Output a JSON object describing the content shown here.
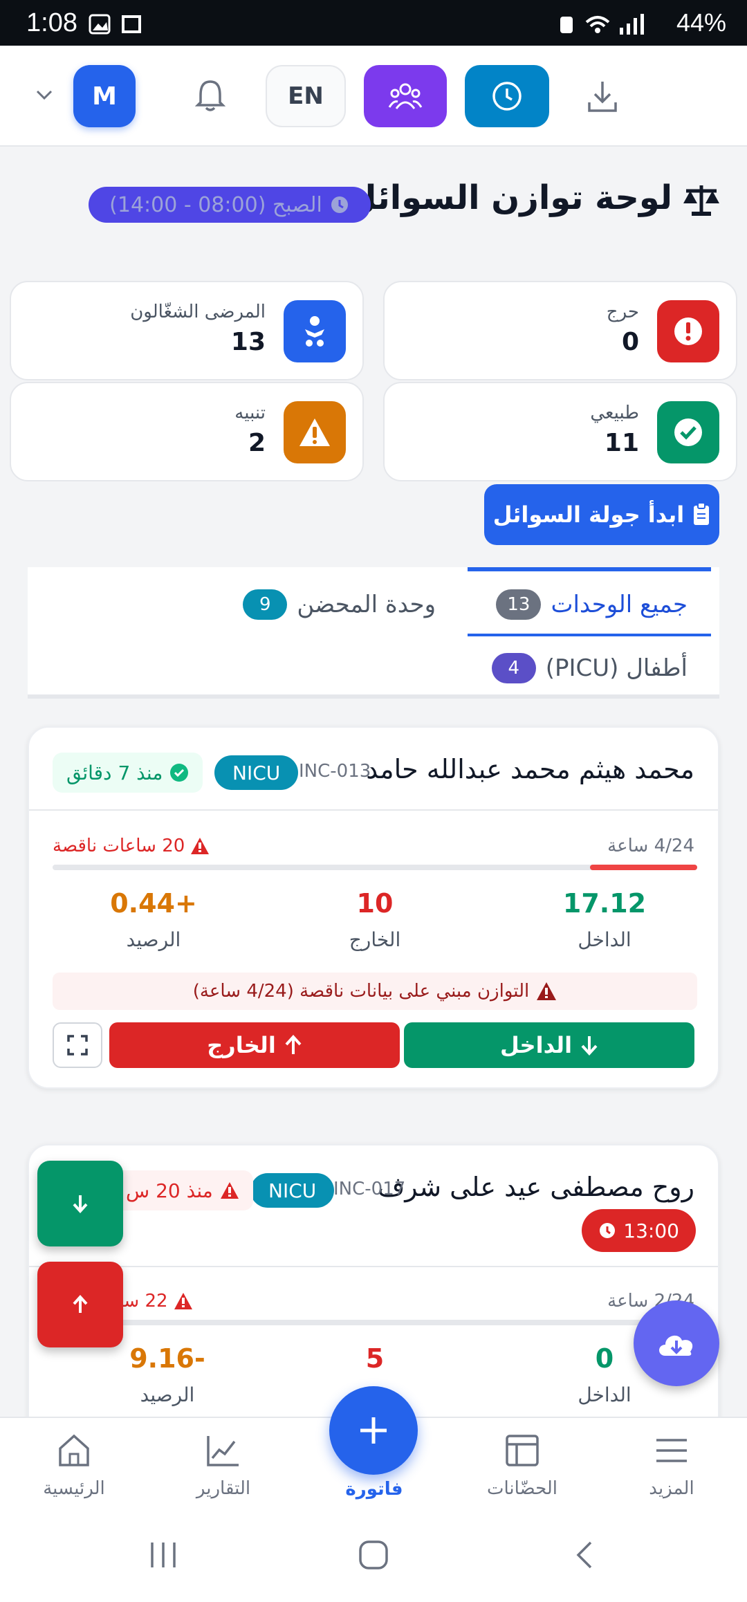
{
  "status_bar": {
    "time": "1:08",
    "battery": "44%"
  },
  "topbar": {
    "avatar_letter": "M",
    "language": "EN"
  },
  "page": {
    "title": "لوحة توازن السوائل",
    "shift": "الصبح (08:00 - 14:00)"
  },
  "stats": [
    {
      "label": "حرج",
      "value": "0",
      "color": "#dc2626",
      "icon": "alert-circle-icon"
    },
    {
      "label": "المرضى الشغّالون",
      "value": "13",
      "color": "#2563eb",
      "icon": "baby-icon"
    },
    {
      "label": "طبيعي",
      "value": "11",
      "color": "#059669",
      "icon": "check-circle-icon"
    },
    {
      "label": "تنبيه",
      "value": "2",
      "color": "#d97706",
      "icon": "warning-icon"
    }
  ],
  "start_round_label": "ابدأ جولة السوائل",
  "tabs": [
    {
      "label": "جميع الوحدات",
      "count": "13",
      "active": true
    },
    {
      "label": "وحدة المحضن",
      "count": "9"
    },
    {
      "label": "أطفال (PICU)",
      "count": "4"
    }
  ],
  "patients": [
    {
      "name": "محمد هيثم محمد عبدالله حامد",
      "id": "INC-013",
      "unit": "NICU",
      "updated": "منذ 7 دقائق",
      "hours": "4/24 ساعة",
      "missing": "20 ساعات ناقصة",
      "progress": 0.1667,
      "intake": "17.12",
      "intake_label": "الداخل",
      "output": "10",
      "output_label": "الخارج",
      "balance": "0.44+",
      "balance_label": "الرصيد",
      "warning": "التوازن مبني على بيانات ناقصة (4/24 ساعة)",
      "btn_in": "الداخل",
      "btn_out": "الخارج"
    },
    {
      "name": "روح مصطفى عيد على شرف",
      "id": "INC-017",
      "unit": "NICU",
      "updated": "منذ 20 س",
      "due": "13:00",
      "hours": "2/24 ساعة",
      "missing": "22 ساعة",
      "intake": "0",
      "intake_label": "الداخل",
      "output": "5",
      "balance": "9.16-",
      "balance_label": "الرصيد"
    }
  ],
  "bottom_nav": [
    {
      "label": "الرئيسية",
      "icon": "home-icon"
    },
    {
      "label": "التقارير",
      "icon": "chart-icon"
    },
    {
      "label": "فاتورة",
      "icon": "plus-icon"
    },
    {
      "label": "الحضّانات",
      "icon": "layout-icon"
    },
    {
      "label": "المزيد",
      "icon": "menu-icon"
    }
  ],
  "colors": {
    "primary": "#2563eb",
    "danger": "#dc2626",
    "success": "#059669",
    "warning": "#d97706"
  }
}
